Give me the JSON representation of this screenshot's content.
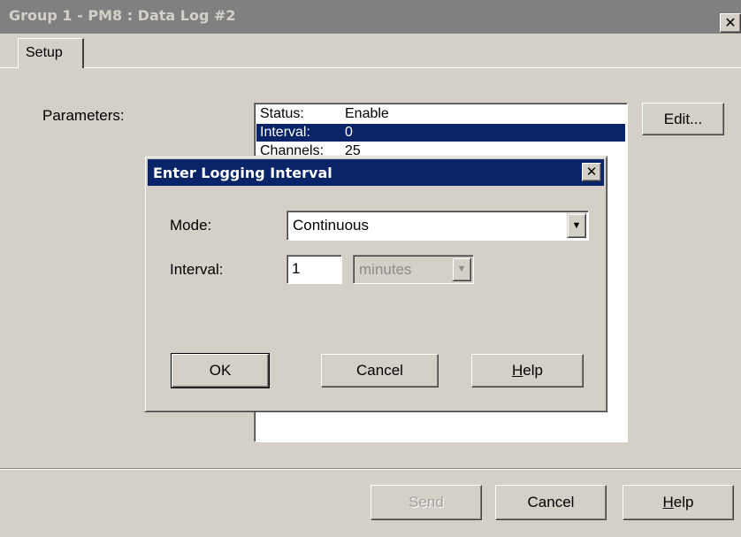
{
  "window": {
    "title": "Group 1 - PM8 : Data Log #2",
    "close_glyph": "✕"
  },
  "tabs": [
    {
      "label": "Setup",
      "active": true
    }
  ],
  "parameters": {
    "label": "Parameters:",
    "rows": [
      {
        "key": "Status:",
        "value": "Enable",
        "selected": false
      },
      {
        "key": "Interval:",
        "value": "0",
        "selected": true
      },
      {
        "key": "Channels:",
        "value": "25",
        "selected": false
      }
    ],
    "edit_button": "Edit..."
  },
  "footer": {
    "send_button": "Send",
    "cancel_button": "Cancel",
    "help_button_rest": "elp",
    "help_button_mnemonic": "H"
  },
  "dialog": {
    "title": "Enter Logging Interval",
    "close_glyph": "✕",
    "mode_label": "Mode:",
    "mode_value": "Continuous",
    "interval_label": "Interval:",
    "interval_value": "1",
    "units_value": "minutes",
    "dropdown_glyph": "▼",
    "ok_button": "OK",
    "cancel_button": "Cancel",
    "help_button_mnemonic": "H",
    "help_button_rest": "elp"
  },
  "colors": {
    "window_bg": "#d4d0c8",
    "inactive_title": "#808080",
    "active_title": "#0a246a",
    "selection": "#0a246a"
  }
}
